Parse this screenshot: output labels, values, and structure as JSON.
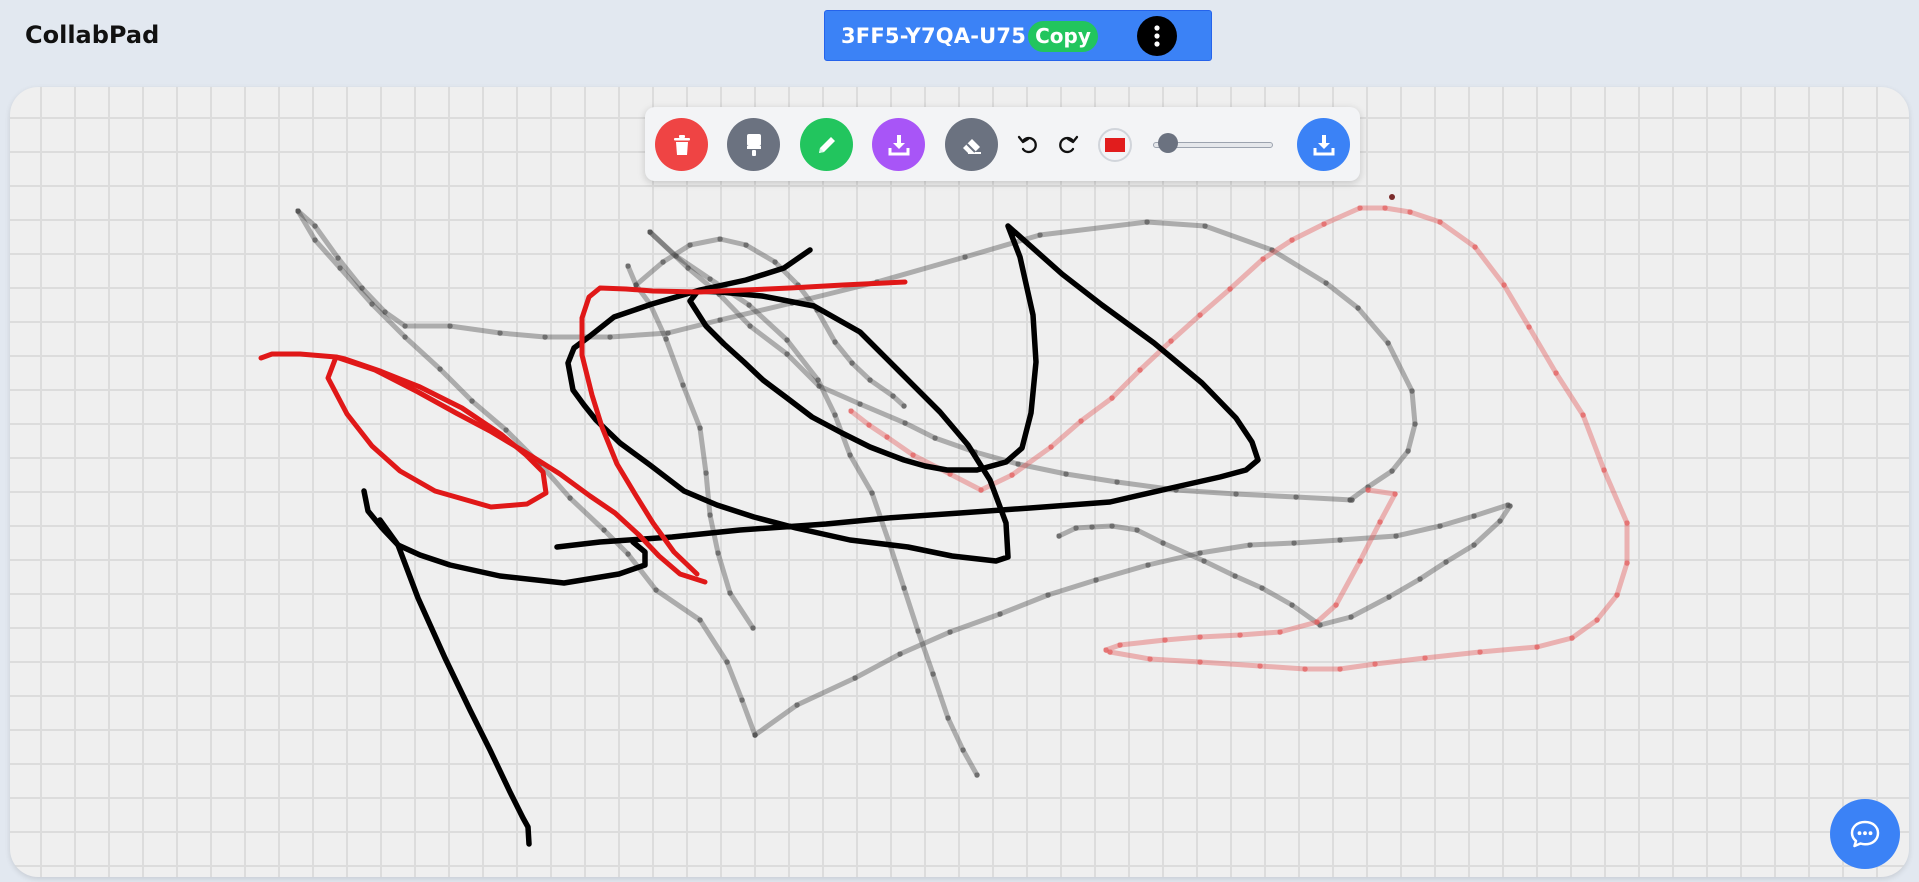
{
  "app": {
    "title": "CollabPad"
  },
  "room": {
    "code": "3FF5-Y7QA-U75",
    "copy_label": "Copy"
  },
  "toolbar": {
    "tools": [
      {
        "name": "trash-icon",
        "color": "#ef4444"
      },
      {
        "name": "brush-icon",
        "color": "#6b7280"
      },
      {
        "name": "pencil-icon",
        "color": "#22c55e"
      },
      {
        "name": "save-icon",
        "color": "#a855f7"
      },
      {
        "name": "eraser-icon",
        "color": "#6b7280"
      },
      {
        "name": "undo-icon"
      },
      {
        "name": "redo-icon"
      }
    ],
    "stroke_color": "#e11d1d",
    "brush_size_fraction": 0.05,
    "download_color": "#3b82f6"
  },
  "colors": {
    "accent": "#3b82f6",
    "copy": "#22c55e",
    "canvas": "#efefef",
    "grid": "#dcdcdc"
  },
  "chat": {
    "icon": "chat-icon"
  }
}
